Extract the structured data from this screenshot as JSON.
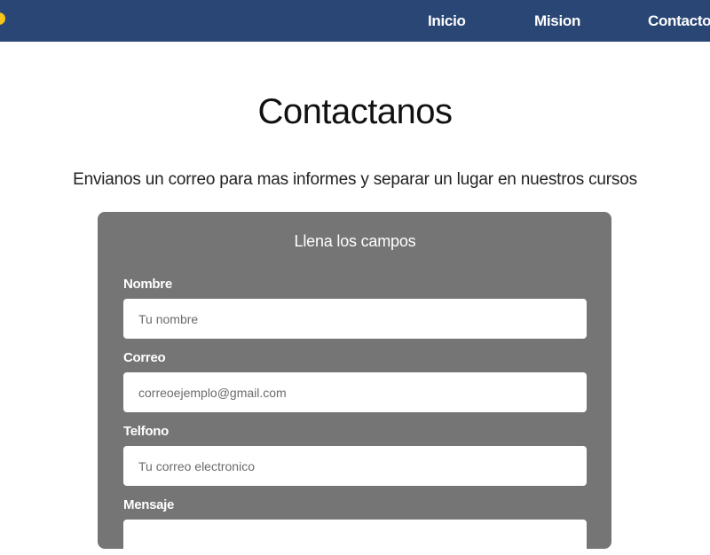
{
  "nav": {
    "items": [
      {
        "label": "Inicio"
      },
      {
        "label": "Mision"
      },
      {
        "label": "Contacto"
      }
    ]
  },
  "page": {
    "title": "Contactanos",
    "subtitle": "Envianos un correo para mas informes y separar un lugar en nuestros cursos"
  },
  "form": {
    "heading": "Llena los campos",
    "fields": [
      {
        "label": "Nombre",
        "placeholder": "Tu nombre"
      },
      {
        "label": "Correo",
        "placeholder": "correoejemplo@gmail.com"
      },
      {
        "label": "Telfono",
        "placeholder": "Tu correo electronico"
      },
      {
        "label": "Mensaje",
        "placeholder": ""
      }
    ]
  },
  "colors": {
    "navbar": "#2a4675",
    "logo": "#f5c518",
    "form_background": "#757575"
  }
}
